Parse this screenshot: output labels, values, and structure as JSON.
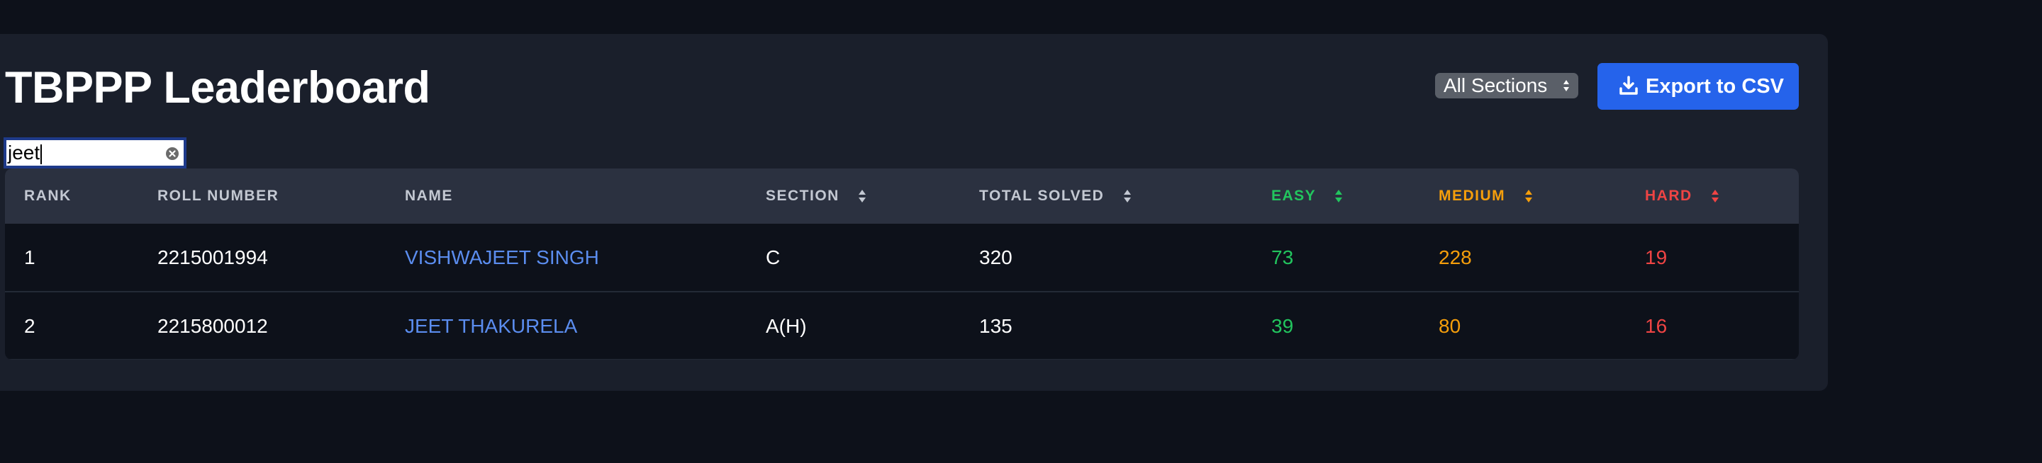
{
  "header": {
    "title": "TBPPP Leaderboard",
    "section_filter": "All Sections",
    "export_label": "Export to CSV"
  },
  "search": {
    "value": "jeet"
  },
  "table": {
    "columns": {
      "rank": "RANK",
      "roll": "ROLL NUMBER",
      "name": "NAME",
      "section": "SECTION",
      "total": "TOTAL SOLVED",
      "easy": "EASY",
      "medium": "MEDIUM",
      "hard": "HARD"
    },
    "rows": [
      {
        "rank": "1",
        "roll": "2215001994",
        "name": "VISHWAJEET SINGH",
        "section": "C",
        "total": "320",
        "easy": "73",
        "medium": "228",
        "hard": "19"
      },
      {
        "rank": "2",
        "roll": "2215800012",
        "name": "JEET THAKURELA",
        "section": "A(H)",
        "total": "135",
        "easy": "39",
        "medium": "80",
        "hard": "16"
      }
    ]
  },
  "colors": {
    "accent": "#2563eb",
    "easy": "#22c55e",
    "medium": "#f59e0b",
    "hard": "#ef4444",
    "name_link": "#5b8def"
  },
  "icons": {
    "export": "download-icon",
    "sort": "sort-icon",
    "clear": "clear-icon",
    "select": "select-arrows-icon"
  }
}
